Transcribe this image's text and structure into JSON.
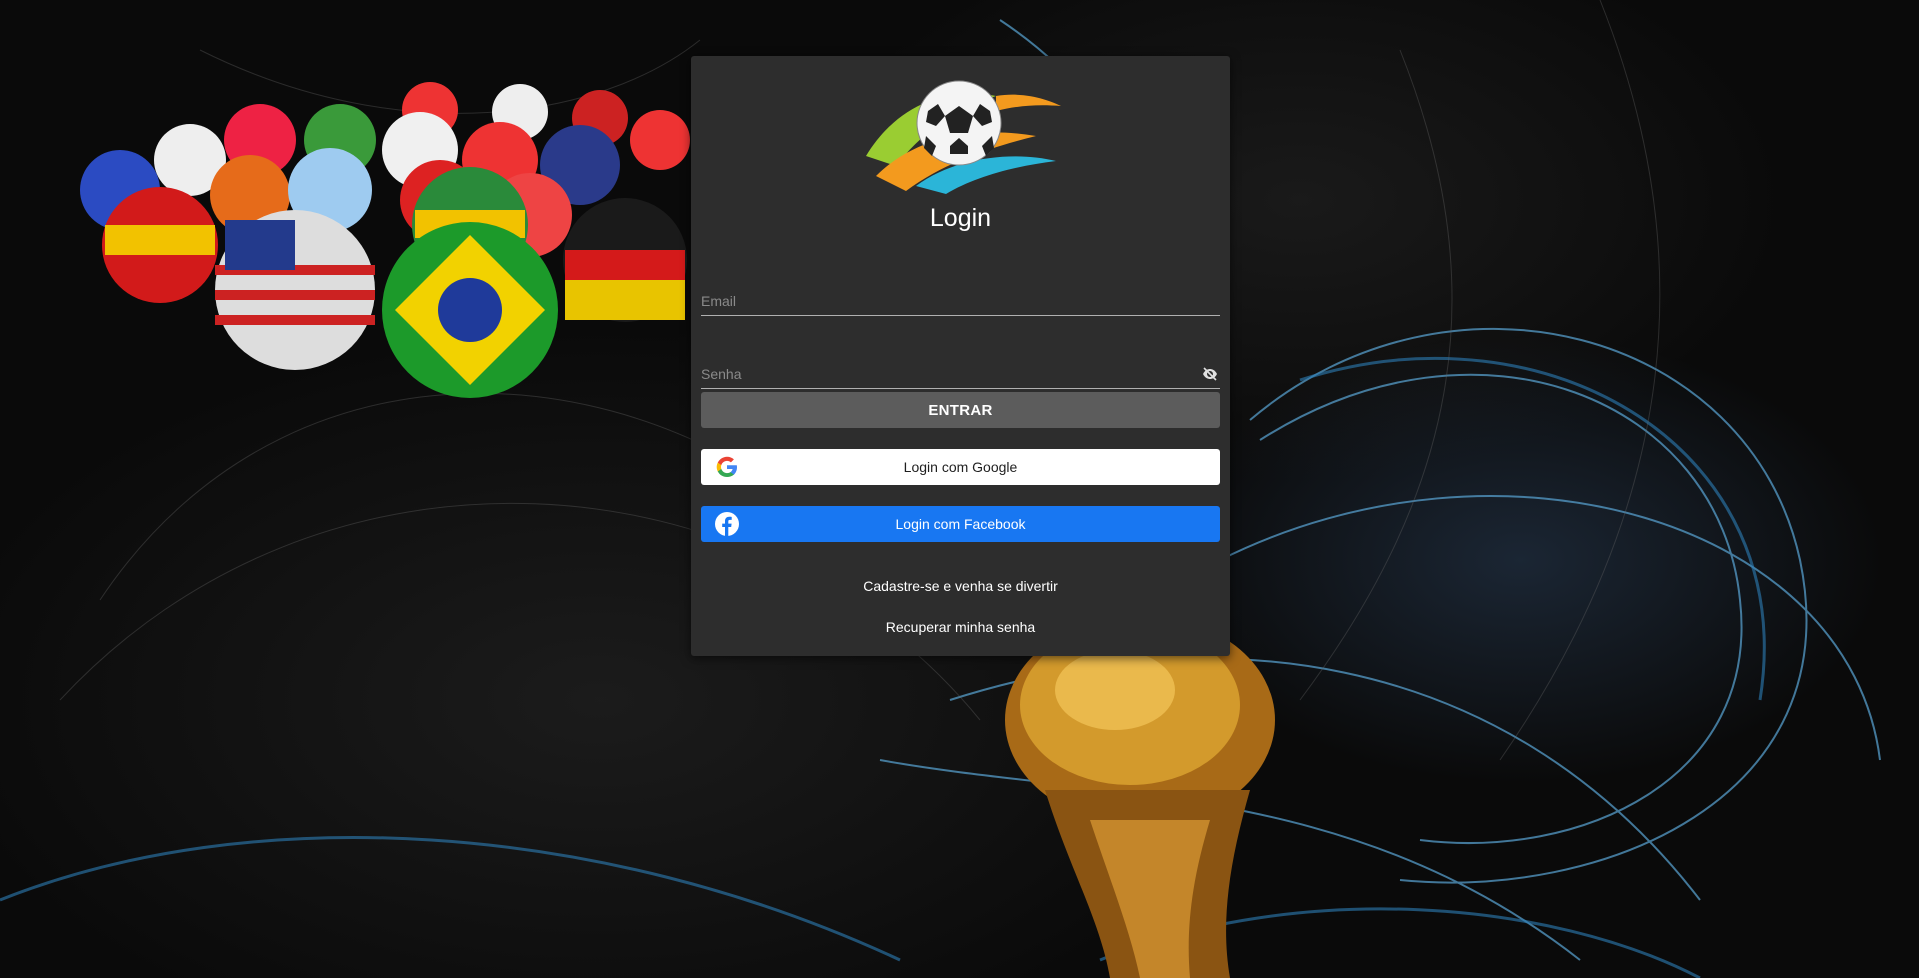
{
  "login": {
    "title": "Login",
    "email_placeholder": "Email",
    "senha_placeholder": "Senha",
    "entrar_label": "ENTRAR",
    "google_label": "Login com Google",
    "facebook_label": "Login com Facebook",
    "cadastro_link": "Cadastre-se e venha se divertir",
    "recuperar_link": "Recuperar minha senha"
  },
  "icons": {
    "logo": "soccer-ball-logo",
    "password_toggle": "eye-off-icon",
    "google": "google-g-icon",
    "facebook": "facebook-f-icon"
  },
  "colors": {
    "card": "#2d2d2d",
    "entrar_button": "#5c5c5c",
    "google_button": "#ffffff",
    "facebook_button": "#1877f2"
  }
}
